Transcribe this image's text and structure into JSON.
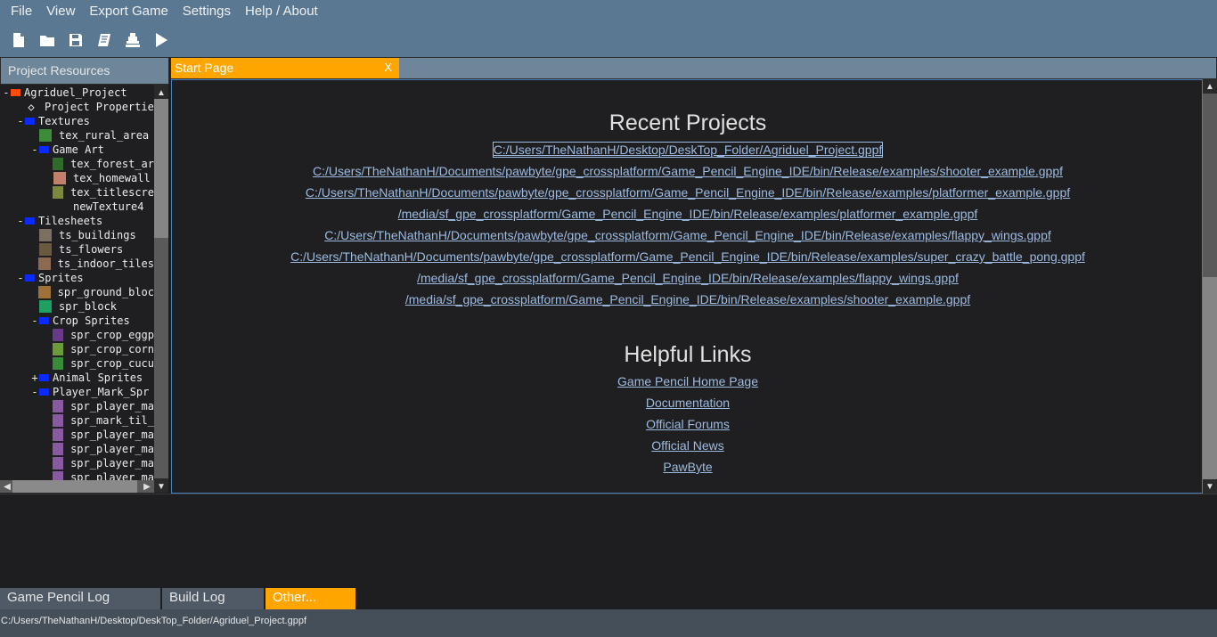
{
  "menu": [
    "File",
    "View",
    "Export Game",
    "Settings",
    "Help / About"
  ],
  "toolbar": [
    "new-file-icon",
    "open-folder-icon",
    "save-icon",
    "save-all-icon",
    "build-icon",
    "play-icon"
  ],
  "resources": {
    "header": "Project Resources",
    "tree": [
      {
        "label": "Agriduel_Project",
        "toggle": "-",
        "icon": "root-folder",
        "indent": 0
      },
      {
        "label": "Project Propertie",
        "toggle": "",
        "icon": "properties",
        "indent": 1
      },
      {
        "label": "Textures",
        "toggle": "-",
        "icon": "folder",
        "indent": 1
      },
      {
        "label": "tex_rural_area",
        "toggle": "",
        "icon": "thumb-green",
        "indent": 2
      },
      {
        "label": "Game Art",
        "toggle": "-",
        "icon": "folder",
        "indent": 2
      },
      {
        "label": "tex_forest_ar",
        "toggle": "",
        "icon": "thumb-forest",
        "indent": 3
      },
      {
        "label": "tex_homewall",
        "toggle": "",
        "icon": "thumb-wall",
        "indent": 3
      },
      {
        "label": "tex_titlescre",
        "toggle": "",
        "icon": "thumb-title",
        "indent": 3
      },
      {
        "label": "newTexture4",
        "toggle": "",
        "icon": "thumb-blank",
        "indent": 3
      },
      {
        "label": "Tilesheets",
        "toggle": "-",
        "icon": "folder",
        "indent": 1
      },
      {
        "label": "ts_buildings",
        "toggle": "",
        "icon": "thumb-tiles",
        "indent": 2
      },
      {
        "label": "ts_flowers",
        "toggle": "",
        "icon": "thumb-flowers",
        "indent": 2
      },
      {
        "label": "ts_indoor_tiles",
        "toggle": "",
        "icon": "thumb-indoor",
        "indent": 2
      },
      {
        "label": "Sprites",
        "toggle": "-",
        "icon": "folder",
        "indent": 1
      },
      {
        "label": "spr_ground_bloc",
        "toggle": "",
        "icon": "thumb-ground",
        "indent": 2
      },
      {
        "label": "spr_block",
        "toggle": "",
        "icon": "thumb-block",
        "indent": 2
      },
      {
        "label": "Crop Sprites",
        "toggle": "-",
        "icon": "folder",
        "indent": 2
      },
      {
        "label": "spr_crop_eggp",
        "toggle": "",
        "icon": "thumb-crop-eggplant",
        "indent": 3
      },
      {
        "label": "spr_crop_corn",
        "toggle": "",
        "icon": "thumb-crop-corn",
        "indent": 3
      },
      {
        "label": "spr_crop_cucu",
        "toggle": "",
        "icon": "thumb-crop-cucumber",
        "indent": 3
      },
      {
        "label": "Animal Sprites",
        "toggle": "+",
        "icon": "folder",
        "indent": 2
      },
      {
        "label": "Player_Mark_Spr",
        "toggle": "-",
        "icon": "folder",
        "indent": 2
      },
      {
        "label": "spr_player_ma",
        "toggle": "",
        "icon": "thumb-player",
        "indent": 3
      },
      {
        "label": "spr_mark_til_",
        "toggle": "",
        "icon": "thumb-player",
        "indent": 3
      },
      {
        "label": "spr_player_ma",
        "toggle": "",
        "icon": "thumb-player",
        "indent": 3
      },
      {
        "label": "spr_player_ma",
        "toggle": "",
        "icon": "thumb-player",
        "indent": 3
      },
      {
        "label": "spr_player_ma",
        "toggle": "",
        "icon": "thumb-player",
        "indent": 3
      },
      {
        "label": "spr_player_ma",
        "toggle": "",
        "icon": "thumb-player",
        "indent": 3
      }
    ]
  },
  "tab": {
    "label": "Start Page",
    "close": "X"
  },
  "start_page": {
    "recent_title": "Recent Projects",
    "recent": [
      "C:/Users/TheNathanH/Desktop/DeskTop_Folder/Agriduel_Project.gppf",
      "C:/Users/TheNathanH/Documents/pawbyte/gpe_crossplatform/Game_Pencil_Engine_IDE/bin/Release/examples/shooter_example.gppf",
      "C:/Users/TheNathanH/Documents/pawbyte/gpe_crossplatform/Game_Pencil_Engine_IDE/bin/Release/examples/platformer_example.gppf",
      "/media/sf_gpe_crossplatform/Game_Pencil_Engine_IDE/bin/Release/examples/platformer_example.gppf",
      "C:/Users/TheNathanH/Documents/pawbyte/gpe_crossplatform/Game_Pencil_Engine_IDE/bin/Release/examples/flappy_wings.gppf",
      "C:/Users/TheNathanH/Documents/pawbyte/gpe_crossplatform/Game_Pencil_Engine_IDE/bin/Release/examples/super_crazy_battle_pong.gppf",
      "/media/sf_gpe_crossplatform/Game_Pencil_Engine_IDE/bin/Release/examples/flappy_wings.gppf",
      "/media/sf_gpe_crossplatform/Game_Pencil_Engine_IDE/bin/Release/examples/shooter_example.gppf"
    ],
    "helpful_title": "Helpful Links",
    "helpful": [
      "Game Pencil Home Page",
      "Documentation",
      "Official Forums",
      "Official News",
      "PawByte"
    ]
  },
  "bottom_tabs": [
    {
      "label": "Game Pencil Log",
      "active": false
    },
    {
      "label": "Build Log",
      "active": false
    },
    {
      "label": "Other...",
      "active": true
    }
  ],
  "status": "C:/Users/TheNathanH/Desktop/DeskTop_Folder/Agriduel_Project.gppf",
  "colors": {
    "accent": "#ffa500",
    "chrome": "#5b7893",
    "link": "#9dbbe0",
    "root_folder": "#ff4a0a",
    "folder": "#0b28ff"
  }
}
